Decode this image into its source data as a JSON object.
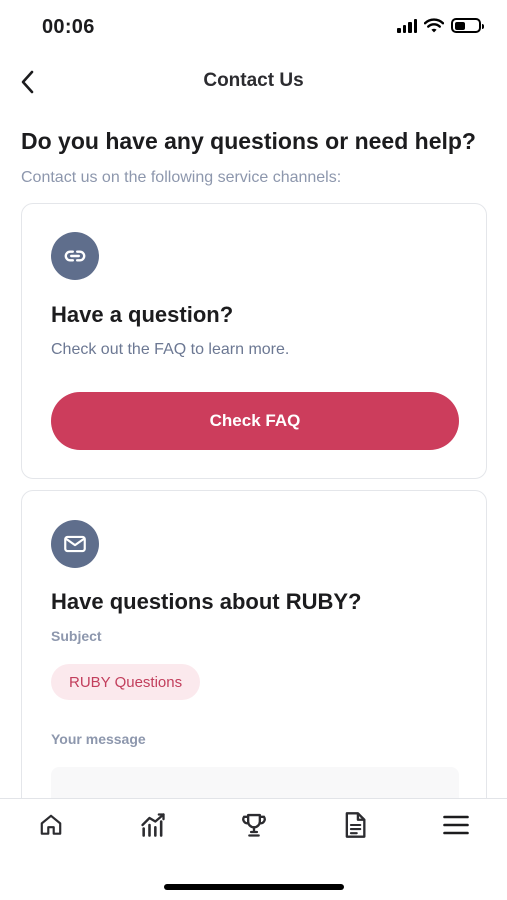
{
  "status_bar": {
    "time": "00:06"
  },
  "header": {
    "title": "Contact Us",
    "back_icon": "chevron-left-icon"
  },
  "intro": {
    "heading": "Do you have any questions or need help?",
    "subheading": "Contact us on the following service channels:"
  },
  "faq_card": {
    "icon": "link-icon",
    "title": "Have a question?",
    "description": "Check out the FAQ to learn more.",
    "button_label": "Check FAQ"
  },
  "ruby_card": {
    "icon": "mail-icon",
    "title": "Have questions about RUBY?",
    "subject_label": "Subject",
    "subject_value": "RUBY Questions",
    "message_label": "Your message"
  },
  "tab_bar": {
    "tabs": [
      {
        "icon": "home-icon"
      },
      {
        "icon": "chart-icon"
      },
      {
        "icon": "trophy-icon"
      },
      {
        "icon": "document-icon"
      },
      {
        "icon": "menu-icon"
      }
    ]
  },
  "colors": {
    "accent": "#cc3d5c",
    "icon_circle": "#5f6e8c",
    "chip_bg": "#fbe9ed",
    "muted_text": "#8d97ad"
  }
}
